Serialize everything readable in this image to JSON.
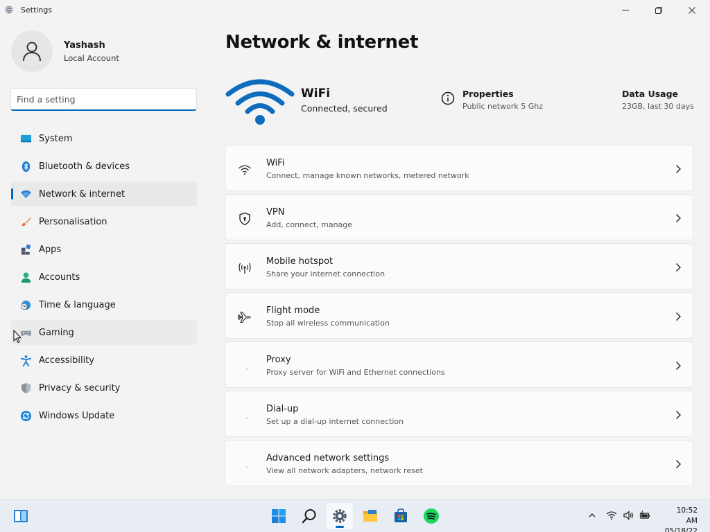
{
  "window": {
    "title": "Settings",
    "app_icon": "gear-icon"
  },
  "profile": {
    "name": "Yashash",
    "account_type": "Local Account"
  },
  "search": {
    "placeholder": "Find a setting"
  },
  "sidebar": {
    "items": [
      {
        "label": "System",
        "icon": "monitor-icon"
      },
      {
        "label": "Bluetooth & devices",
        "icon": "bluetooth-icon"
      },
      {
        "label": "Network & internet",
        "icon": "wifi-diamond-icon",
        "active": true
      },
      {
        "label": "Personalisation",
        "icon": "brush-icon"
      },
      {
        "label": "Apps",
        "icon": "apps-icon"
      },
      {
        "label": "Accounts",
        "icon": "person-icon"
      },
      {
        "label": "Time & language",
        "icon": "globe-clock-icon"
      },
      {
        "label": "Gaming",
        "icon": "gamepad-icon",
        "hovered": true
      },
      {
        "label": "Accessibility",
        "icon": "accessibility-icon"
      },
      {
        "label": "Privacy & security",
        "icon": "shield-icon"
      },
      {
        "label": "Windows Update",
        "icon": "update-icon"
      }
    ]
  },
  "main": {
    "title": "Network & internet",
    "status": {
      "title": "WiFi",
      "subtitle": "Connected, secured"
    },
    "properties": {
      "title": "Properties",
      "subtitle": "Public network 5 Ghz"
    },
    "data_usage": {
      "title": "Data Usage",
      "subtitle": "23GB, last 30 days"
    },
    "cards": [
      {
        "title": "WiFi",
        "subtitle": "Connect, manage known networks, metered network",
        "icon": "wifi-icon"
      },
      {
        "title": "VPN",
        "subtitle": "Add, connect, manage",
        "icon": "vpn-shield-icon"
      },
      {
        "title": "Mobile hotspot",
        "subtitle": "Share your internet connection",
        "icon": "hotspot-icon"
      },
      {
        "title": "Flight mode",
        "subtitle": "Stop all wireless communication",
        "icon": "airplane-icon"
      },
      {
        "title": "Proxy",
        "subtitle": "Proxy server for WiFi and Ethernet connections",
        "icon": "proxy-icon"
      },
      {
        "title": "Dial-up",
        "subtitle": "Set up a dial-up internet connection",
        "icon": "dialup-icon"
      },
      {
        "title": "Advanced network settings",
        "subtitle": "View all network adapters, network reset",
        "icon": "advanced-network-icon"
      }
    ]
  },
  "taskbar": {
    "clock_time": "10:52 AM",
    "clock_date": "05/18/22"
  },
  "colors": {
    "accent": "#0067c0",
    "wifi_blue": "#0f6cbd"
  }
}
